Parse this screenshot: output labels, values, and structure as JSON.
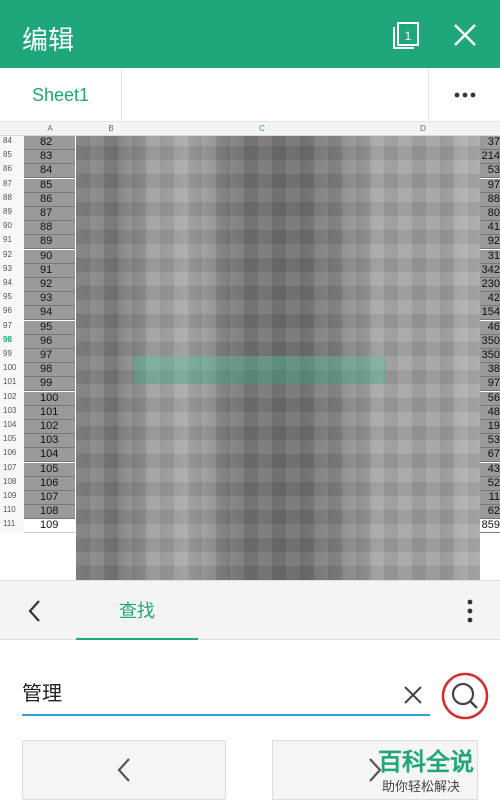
{
  "header": {
    "title": "编辑",
    "sheet_count_icon": "sheets-copy-icon",
    "close_icon": "close-icon"
  },
  "sheetbar": {
    "tab_label": "Sheet1",
    "more_icon": "more-horizontal-icon"
  },
  "grid": {
    "columns": [
      "A",
      "B",
      "C",
      "D"
    ],
    "active_column": "C",
    "active_row": "98",
    "rows": [
      {
        "num": "84",
        "a": "82",
        "e": "37"
      },
      {
        "num": "85",
        "a": "83",
        "e": "214"
      },
      {
        "num": "86",
        "a": "84",
        "e": "53"
      },
      {
        "num": "87",
        "a": "85",
        "e": "97"
      },
      {
        "num": "88",
        "a": "86",
        "e": "88"
      },
      {
        "num": "89",
        "a": "87",
        "e": "80"
      },
      {
        "num": "90",
        "a": "88",
        "e": "41"
      },
      {
        "num": "91",
        "a": "89",
        "e": "92"
      },
      {
        "num": "92",
        "a": "90",
        "e": "31"
      },
      {
        "num": "93",
        "a": "91",
        "e": "342"
      },
      {
        "num": "94",
        "a": "92",
        "e": "230"
      },
      {
        "num": "95",
        "a": "93",
        "e": "42"
      },
      {
        "num": "96",
        "a": "94",
        "e": "154"
      },
      {
        "num": "97",
        "a": "95",
        "e": "46"
      },
      {
        "num": "98",
        "a": "96",
        "e": "350"
      },
      {
        "num": "99",
        "a": "97",
        "e": "350"
      },
      {
        "num": "100",
        "a": "98",
        "e": "38"
      },
      {
        "num": "101",
        "a": "99",
        "e": "97"
      },
      {
        "num": "102",
        "a": "100",
        "e": "56"
      },
      {
        "num": "103",
        "a": "101",
        "e": "48"
      },
      {
        "num": "104",
        "a": "102",
        "e": "19"
      },
      {
        "num": "105",
        "a": "103",
        "e": "53"
      },
      {
        "num": "106",
        "a": "104",
        "e": "67"
      },
      {
        "num": "107",
        "a": "105",
        "e": "43"
      },
      {
        "num": "108",
        "a": "106",
        "e": "52"
      },
      {
        "num": "109",
        "a": "107",
        "e": "11"
      },
      {
        "num": "110",
        "a": "108",
        "e": "62"
      },
      {
        "num": "111",
        "a": "109",
        "e": "859"
      }
    ]
  },
  "findbar": {
    "back_icon": "chevron-left-icon",
    "tab_label": "查找",
    "more_icon": "more-vertical-icon"
  },
  "search": {
    "value": "管理",
    "placeholder": "",
    "clear_icon": "clear-icon",
    "search_icon": "search-icon"
  },
  "nav": {
    "prev_icon": "chevron-left-icon",
    "next_icon": "chevron-right-icon"
  },
  "watermark": {
    "line1": "百科全说",
    "line2": "助你轻松解决"
  },
  "colors": {
    "brand": "#1fa67a",
    "input_underline": "#2aa4d8",
    "annotation": "#d32f2f"
  }
}
